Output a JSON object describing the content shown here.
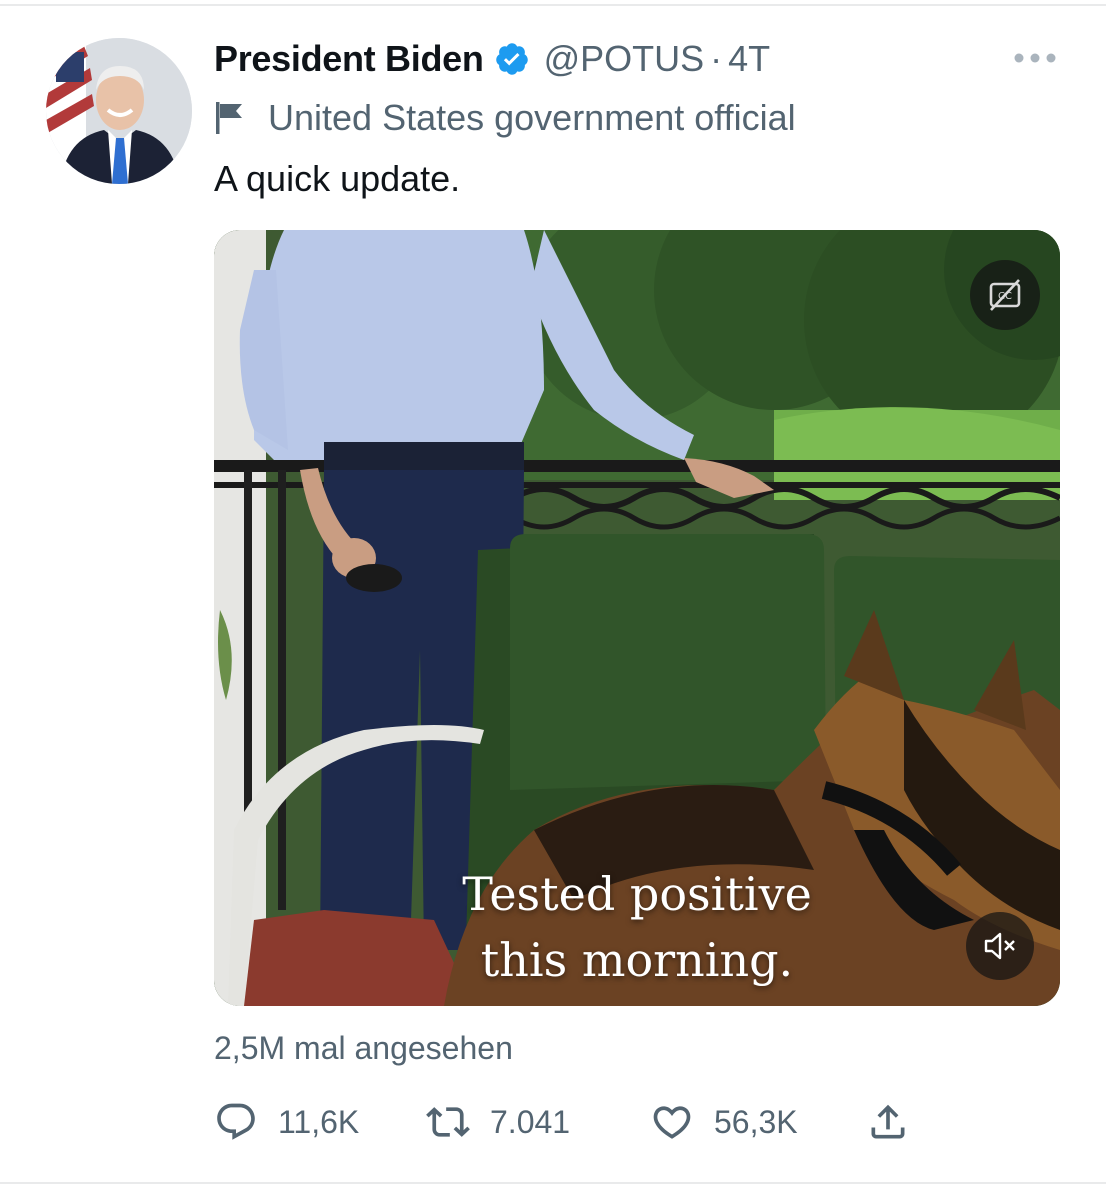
{
  "colors": {
    "text_primary": "#0f1419",
    "text_secondary": "#536471",
    "verified_blue": "#1d9bf0",
    "divider": "#e9eaeb"
  },
  "author": {
    "display_name": "President Biden",
    "handle": "@POTUS",
    "separator": "·",
    "time": "4T",
    "verified_icon": "verified-badge-icon",
    "label_icon": "flag-icon",
    "label": "United States government official",
    "avatar_icon": "profile-photo"
  },
  "tweet": {
    "text": "A quick update."
  },
  "media": {
    "caption_line_1": "Tested positive",
    "caption_line_2": "this morning.",
    "cc_icon": "closed-captions-icon",
    "mute_icon": "speaker-muted-icon"
  },
  "stats": {
    "views": "2,5M mal angesehen"
  },
  "actions": {
    "reply": {
      "icon": "reply-bubble-icon",
      "count": "11,6K"
    },
    "retweet": {
      "icon": "retweet-icon",
      "count": "7.041"
    },
    "like": {
      "icon": "heart-icon",
      "count": "56,3K"
    },
    "share": {
      "icon": "share-icon"
    }
  },
  "menu": {
    "icon": "more-horizontal-icon"
  }
}
